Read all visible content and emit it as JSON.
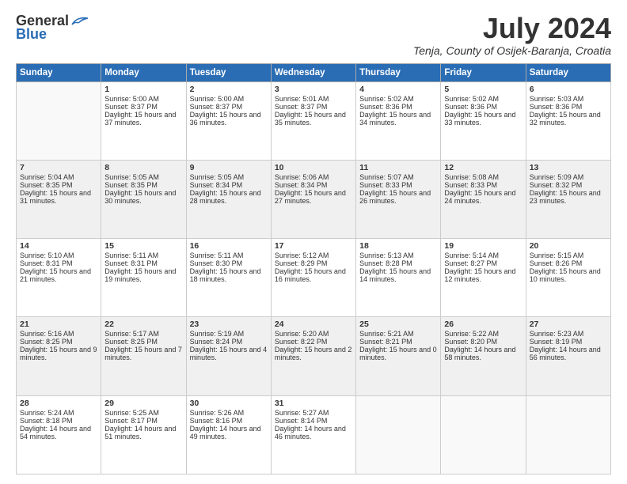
{
  "header": {
    "title": "July 2024",
    "location": "Tenja, County of Osijek-Baranja, Croatia"
  },
  "columns": [
    "Sunday",
    "Monday",
    "Tuesday",
    "Wednesday",
    "Thursday",
    "Friday",
    "Saturday"
  ],
  "weeks": [
    [
      {
        "day": "",
        "sunrise": "",
        "sunset": "",
        "daylight": ""
      },
      {
        "day": "1",
        "sunrise": "Sunrise: 5:00 AM",
        "sunset": "Sunset: 8:37 PM",
        "daylight": "Daylight: 15 hours and 37 minutes."
      },
      {
        "day": "2",
        "sunrise": "Sunrise: 5:00 AM",
        "sunset": "Sunset: 8:37 PM",
        "daylight": "Daylight: 15 hours and 36 minutes."
      },
      {
        "day": "3",
        "sunrise": "Sunrise: 5:01 AM",
        "sunset": "Sunset: 8:37 PM",
        "daylight": "Daylight: 15 hours and 35 minutes."
      },
      {
        "day": "4",
        "sunrise": "Sunrise: 5:02 AM",
        "sunset": "Sunset: 8:36 PM",
        "daylight": "Daylight: 15 hours and 34 minutes."
      },
      {
        "day": "5",
        "sunrise": "Sunrise: 5:02 AM",
        "sunset": "Sunset: 8:36 PM",
        "daylight": "Daylight: 15 hours and 33 minutes."
      },
      {
        "day": "6",
        "sunrise": "Sunrise: 5:03 AM",
        "sunset": "Sunset: 8:36 PM",
        "daylight": "Daylight: 15 hours and 32 minutes."
      }
    ],
    [
      {
        "day": "7",
        "sunrise": "Sunrise: 5:04 AM",
        "sunset": "Sunset: 8:35 PM",
        "daylight": "Daylight: 15 hours and 31 minutes."
      },
      {
        "day": "8",
        "sunrise": "Sunrise: 5:05 AM",
        "sunset": "Sunset: 8:35 PM",
        "daylight": "Daylight: 15 hours and 30 minutes."
      },
      {
        "day": "9",
        "sunrise": "Sunrise: 5:05 AM",
        "sunset": "Sunset: 8:34 PM",
        "daylight": "Daylight: 15 hours and 28 minutes."
      },
      {
        "day": "10",
        "sunrise": "Sunrise: 5:06 AM",
        "sunset": "Sunset: 8:34 PM",
        "daylight": "Daylight: 15 hours and 27 minutes."
      },
      {
        "day": "11",
        "sunrise": "Sunrise: 5:07 AM",
        "sunset": "Sunset: 8:33 PM",
        "daylight": "Daylight: 15 hours and 26 minutes."
      },
      {
        "day": "12",
        "sunrise": "Sunrise: 5:08 AM",
        "sunset": "Sunset: 8:33 PM",
        "daylight": "Daylight: 15 hours and 24 minutes."
      },
      {
        "day": "13",
        "sunrise": "Sunrise: 5:09 AM",
        "sunset": "Sunset: 8:32 PM",
        "daylight": "Daylight: 15 hours and 23 minutes."
      }
    ],
    [
      {
        "day": "14",
        "sunrise": "Sunrise: 5:10 AM",
        "sunset": "Sunset: 8:31 PM",
        "daylight": "Daylight: 15 hours and 21 minutes."
      },
      {
        "day": "15",
        "sunrise": "Sunrise: 5:11 AM",
        "sunset": "Sunset: 8:31 PM",
        "daylight": "Daylight: 15 hours and 19 minutes."
      },
      {
        "day": "16",
        "sunrise": "Sunrise: 5:11 AM",
        "sunset": "Sunset: 8:30 PM",
        "daylight": "Daylight: 15 hours and 18 minutes."
      },
      {
        "day": "17",
        "sunrise": "Sunrise: 5:12 AM",
        "sunset": "Sunset: 8:29 PM",
        "daylight": "Daylight: 15 hours and 16 minutes."
      },
      {
        "day": "18",
        "sunrise": "Sunrise: 5:13 AM",
        "sunset": "Sunset: 8:28 PM",
        "daylight": "Daylight: 15 hours and 14 minutes."
      },
      {
        "day": "19",
        "sunrise": "Sunrise: 5:14 AM",
        "sunset": "Sunset: 8:27 PM",
        "daylight": "Daylight: 15 hours and 12 minutes."
      },
      {
        "day": "20",
        "sunrise": "Sunrise: 5:15 AM",
        "sunset": "Sunset: 8:26 PM",
        "daylight": "Daylight: 15 hours and 10 minutes."
      }
    ],
    [
      {
        "day": "21",
        "sunrise": "Sunrise: 5:16 AM",
        "sunset": "Sunset: 8:25 PM",
        "daylight": "Daylight: 15 hours and 9 minutes."
      },
      {
        "day": "22",
        "sunrise": "Sunrise: 5:17 AM",
        "sunset": "Sunset: 8:25 PM",
        "daylight": "Daylight: 15 hours and 7 minutes."
      },
      {
        "day": "23",
        "sunrise": "Sunrise: 5:19 AM",
        "sunset": "Sunset: 8:24 PM",
        "daylight": "Daylight: 15 hours and 4 minutes."
      },
      {
        "day": "24",
        "sunrise": "Sunrise: 5:20 AM",
        "sunset": "Sunset: 8:22 PM",
        "daylight": "Daylight: 15 hours and 2 minutes."
      },
      {
        "day": "25",
        "sunrise": "Sunrise: 5:21 AM",
        "sunset": "Sunset: 8:21 PM",
        "daylight": "Daylight: 15 hours and 0 minutes."
      },
      {
        "day": "26",
        "sunrise": "Sunrise: 5:22 AM",
        "sunset": "Sunset: 8:20 PM",
        "daylight": "Daylight: 14 hours and 58 minutes."
      },
      {
        "day": "27",
        "sunrise": "Sunrise: 5:23 AM",
        "sunset": "Sunset: 8:19 PM",
        "daylight": "Daylight: 14 hours and 56 minutes."
      }
    ],
    [
      {
        "day": "28",
        "sunrise": "Sunrise: 5:24 AM",
        "sunset": "Sunset: 8:18 PM",
        "daylight": "Daylight: 14 hours and 54 minutes."
      },
      {
        "day": "29",
        "sunrise": "Sunrise: 5:25 AM",
        "sunset": "Sunset: 8:17 PM",
        "daylight": "Daylight: 14 hours and 51 minutes."
      },
      {
        "day": "30",
        "sunrise": "Sunrise: 5:26 AM",
        "sunset": "Sunset: 8:16 PM",
        "daylight": "Daylight: 14 hours and 49 minutes."
      },
      {
        "day": "31",
        "sunrise": "Sunrise: 5:27 AM",
        "sunset": "Sunset: 8:14 PM",
        "daylight": "Daylight: 14 hours and 46 minutes."
      },
      {
        "day": "",
        "sunrise": "",
        "sunset": "",
        "daylight": ""
      },
      {
        "day": "",
        "sunrise": "",
        "sunset": "",
        "daylight": ""
      },
      {
        "day": "",
        "sunrise": "",
        "sunset": "",
        "daylight": ""
      }
    ]
  ]
}
